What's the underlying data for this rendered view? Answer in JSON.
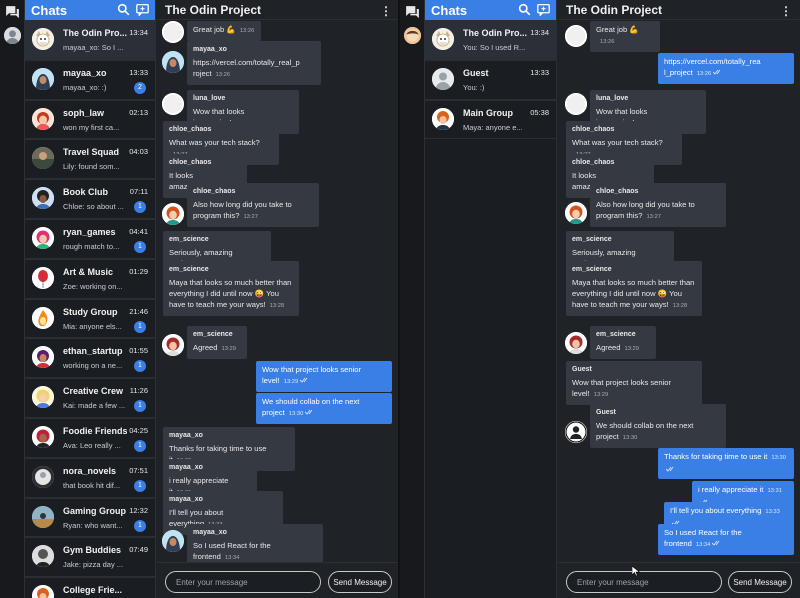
{
  "left": {
    "sidebar": {
      "title": "Chats",
      "items": [
        {
          "name": "The Odin Pro...",
          "preview": "mayaa_xo: So I ...",
          "time": "13:34",
          "badge": "",
          "avatar": "odin"
        },
        {
          "name": "mayaa_xo",
          "preview": "mayaa_xo: :)",
          "time": "13:33",
          "badge": "2",
          "avatar": "hijab"
        },
        {
          "name": "soph_law",
          "preview": "won my first ca...",
          "time": "02:13",
          "badge": "",
          "avatar": "redhair"
        },
        {
          "name": "Travel Squad",
          "preview": "Lily: found som...",
          "time": "04:03",
          "badge": "",
          "avatar": "photo1"
        },
        {
          "name": "Book Club",
          "preview": "Chloe: so about ...",
          "time": "07:11",
          "badge": "1",
          "avatar": "curly"
        },
        {
          "name": "ryan_games",
          "preview": "rough match to...",
          "time": "04:41",
          "badge": "1",
          "avatar": "pinkhair"
        },
        {
          "name": "Art & Music",
          "preview": "Zoe: working on...",
          "time": "01:29",
          "badge": "",
          "avatar": "redballoon"
        },
        {
          "name": "Study Group",
          "preview": "Mia: anyone els...",
          "time": "21:46",
          "badge": "1",
          "avatar": "flame"
        },
        {
          "name": "ethan_startup",
          "preview": "working on a ne...",
          "time": "01:55",
          "badge": "1",
          "avatar": "purple"
        },
        {
          "name": "Creative Crew",
          "preview": "Kai: made a few ...",
          "time": "11:26",
          "badge": "1",
          "avatar": "blonde"
        },
        {
          "name": "Foodie Friends",
          "preview": "Ava: Leo really ...",
          "time": "04:25",
          "badge": "1",
          "avatar": "redface"
        },
        {
          "name": "nora_novels",
          "preview": "that book hit dif...",
          "time": "07:51",
          "badge": "1",
          "avatar": "grey"
        },
        {
          "name": "Gaming Group",
          "preview": "Ryan: who want...",
          "time": "12:32",
          "badge": "1",
          "avatar": "photo2"
        },
        {
          "name": "Gym Buddies",
          "preview": "Jake: pizza day ...",
          "time": "07:49",
          "badge": "",
          "avatar": "mono"
        },
        {
          "name": "College Frie...",
          "preview": "",
          "time": "",
          "badge": "",
          "avatar": "orange"
        }
      ]
    },
    "conversation": {
      "title": "The Odin Project",
      "messages": [
        {
          "author": "",
          "text": "Great job 💪",
          "time": "13:26",
          "mine": false
        },
        {
          "author": "mayaa_xo",
          "text": "https://vercel.com/totally_real_p roject",
          "time": "13:26",
          "mine": false
        },
        {
          "author": "luna_love",
          "text": "Wow that looks impressive!",
          "time": "13:26",
          "mine": false
        },
        {
          "author": "chloe_chaos",
          "text": "What was your tech stack?",
          "time": "13:27",
          "mine": false
        },
        {
          "author": "chloe_chaos",
          "text": "It looks amazing!!!",
          "time": "13:27",
          "mine": false
        },
        {
          "author": "chloe_chaos",
          "text": "Also how long did you take to program this?",
          "time": "13:27",
          "mine": false
        },
        {
          "author": "em_science",
          "text": "Seriously, amazing work",
          "time": "13:28",
          "mine": false
        },
        {
          "author": "em_science",
          "text": "Maya that looks so much better than everything I did until now 😜 You have to teach me your ways!",
          "time": "13:28",
          "mine": false
        },
        {
          "author": "em_science",
          "text": "Agreed",
          "time": "13:29",
          "mine": false
        },
        {
          "author": "",
          "text": "Wow that project looks senior level!",
          "time": "13:29",
          "mine": true
        },
        {
          "author": "",
          "text": "We should collab on the next project",
          "time": "13:30",
          "mine": true
        },
        {
          "author": "mayaa_xo",
          "text": "Thanks for taking time to use it",
          "time": "13:30",
          "mine": false
        },
        {
          "author": "mayaa_xo",
          "text": "i really appreciate it",
          "time": "13:31",
          "mine": false
        },
        {
          "author": "mayaa_xo",
          "text": "I'll tell you about everything",
          "time": "13:33",
          "mine": false
        },
        {
          "author": "mayaa_xo",
          "text": "So I used React for the frontend",
          "time": "13:34",
          "mine": false
        }
      ]
    },
    "composer": {
      "placeholder": "Enter your message",
      "send_label": "Send Message"
    }
  },
  "right": {
    "sidebar": {
      "title": "Chats",
      "items": [
        {
          "name": "The Odin Pro...",
          "preview": "You: So I used R...",
          "time": "13:34",
          "badge": "",
          "avatar": "odin"
        },
        {
          "name": "Guest",
          "preview": "You: :)",
          "time": "13:33",
          "badge": "",
          "avatar": "guest"
        },
        {
          "name": "Main Group",
          "preview": "Maya: anyone e...",
          "time": "05:38",
          "badge": "",
          "avatar": "orange"
        }
      ]
    },
    "conversation": {
      "title": "The Odin Project",
      "messages": [
        {
          "author": "luna_love",
          "text": "Great job 💪",
          "time": "13:26",
          "mine": false
        },
        {
          "author": "",
          "text": "https://vercel.com/totally_rea l_project",
          "time": "13:26",
          "mine": true
        },
        {
          "author": "luna_love",
          "text": "Wow that looks impressive!",
          "time": "13:26",
          "mine": false
        },
        {
          "author": "chloe_chaos",
          "text": "What was your tech stack?",
          "time": "13:27",
          "mine": false
        },
        {
          "author": "chloe_chaos",
          "text": "It looks amazing!!!",
          "time": "13:27",
          "mine": false
        },
        {
          "author": "chloe_chaos",
          "text": "Also how long did you take to program this?",
          "time": "13:27",
          "mine": false
        },
        {
          "author": "em_science",
          "text": "Seriously, amazing work",
          "time": "13:28",
          "mine": false
        },
        {
          "author": "em_science",
          "text": "Maya that looks so much better than everything I did until now 😜 You have to teach me your ways!",
          "time": "13:28",
          "mine": false
        },
        {
          "author": "em_science",
          "text": "Agreed",
          "time": "13:29",
          "mine": false
        },
        {
          "author": "Guest",
          "text": "Wow that project looks senior level!",
          "time": "13:29",
          "mine": false
        },
        {
          "author": "Guest",
          "text": "We should collab on the next project",
          "time": "13:30",
          "mine": false
        },
        {
          "author": "",
          "text": "Thanks for taking time to use it",
          "time": "13:30",
          "mine": true
        },
        {
          "author": "",
          "text": "i really appreciate it",
          "time": "13:31",
          "mine": true
        },
        {
          "author": "",
          "text": "I'll tell you about everything",
          "time": "13:33",
          "mine": true
        },
        {
          "author": "",
          "text": "So I used React for the frontend",
          "time": "13:34",
          "mine": true
        }
      ]
    },
    "composer": {
      "placeholder": "Enter your message",
      "send_label": "Send Message"
    }
  },
  "colors": {
    "accent": "#3a7fe6",
    "bubble": "#353a42",
    "background": "#1f2227"
  },
  "icons": {
    "rail": "chat-bubbles-icon",
    "search": "search-icon",
    "new_chat": "new-chat-icon",
    "menu": "kebab-menu-icon",
    "read": "double-check-icon"
  }
}
